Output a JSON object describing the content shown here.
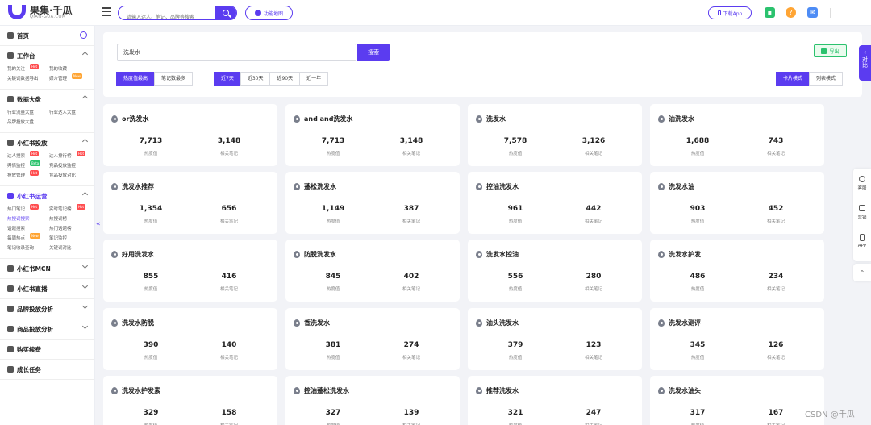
{
  "brand": {
    "name": "果集·千瓜",
    "sub": "QIAN-GUA.COM",
    "accent": "#5b3cf0"
  },
  "topbar": {
    "search_placeholder": "请输入达人、笔记、品牌等搜索",
    "func_map": "功能地图",
    "download_app": "下载App"
  },
  "sidebar": {
    "home": "首页",
    "sections": [
      {
        "title": "工作台",
        "items": [
          {
            "label": "我的关注",
            "badge": "Hot"
          },
          {
            "label": "我的收藏",
            "badge": ""
          },
          {
            "label": "关键词数据导出",
            "badge": ""
          },
          {
            "label": "媒介管理",
            "badge": "New"
          }
        ]
      },
      {
        "title": "数据大盘",
        "items": [
          {
            "label": "行业流量大盘",
            "badge": ""
          },
          {
            "label": "行业达人大盘",
            "badge": ""
          },
          {
            "label": "品牌投放大盘",
            "badge": ""
          }
        ]
      },
      {
        "title": "小红书投放",
        "items": [
          {
            "label": "达人搜索",
            "badge": "Hot"
          },
          {
            "label": "达人排行榜",
            "badge": "Hot"
          },
          {
            "label": "舆情监控",
            "badge": "Beta"
          },
          {
            "label": "竞品投放监控",
            "badge": ""
          },
          {
            "label": "投放管理",
            "badge": "Hot"
          },
          {
            "label": "竞品投放对比",
            "badge": ""
          }
        ]
      },
      {
        "title": "小红书运营",
        "items": [
          {
            "label": "热门笔记",
            "badge": "Hot"
          },
          {
            "label": "实时笔记榜",
            "badge": "Hot"
          },
          {
            "label": "热搜词搜索",
            "badge": ""
          },
          {
            "label": "热搜词榜",
            "badge": ""
          },
          {
            "label": "话题搜索",
            "badge": ""
          },
          {
            "label": "热门话题榜",
            "badge": ""
          },
          {
            "label": "每周热点",
            "badge": "New"
          },
          {
            "label": "笔记监控",
            "badge": ""
          },
          {
            "label": "笔记收录查询",
            "badge": ""
          },
          {
            "label": "关键词对比",
            "badge": ""
          }
        ]
      }
    ],
    "collapsed": [
      "小红书MCN",
      "小红书直播",
      "品牌投放分析",
      "商品投放分析",
      "购买续费",
      "成长任务"
    ]
  },
  "main": {
    "keyword": "洗发水",
    "search_button": "搜索",
    "export": "导出",
    "sort_tabs": [
      "热度值最高",
      "笔记数最多"
    ],
    "time_tabs": [
      "近7天",
      "近30天",
      "近90天",
      "近一年"
    ],
    "view_tabs": [
      "卡片模式",
      "列表模式"
    ],
    "value_label": "热度值",
    "notes_label": "相关笔记"
  },
  "cards": [
    {
      "title": "or洗发水",
      "heat": "7,713",
      "notes": "3,148"
    },
    {
      "title": "and and洗发水",
      "heat": "7,713",
      "notes": "3,148"
    },
    {
      "title": "洗发水",
      "heat": "7,578",
      "notes": "3,126"
    },
    {
      "title": "油洗发水",
      "heat": "1,688",
      "notes": "743"
    },
    {
      "title": "洗发水推荐",
      "heat": "1,354",
      "notes": "656"
    },
    {
      "title": "蓬松洗发水",
      "heat": "1,149",
      "notes": "387"
    },
    {
      "title": "控油洗发水",
      "heat": "961",
      "notes": "442"
    },
    {
      "title": "洗发水油",
      "heat": "903",
      "notes": "452"
    },
    {
      "title": "好用洗发水",
      "heat": "855",
      "notes": "416"
    },
    {
      "title": "防脱洗发水",
      "heat": "845",
      "notes": "402"
    },
    {
      "title": "洗发水控油",
      "heat": "556",
      "notes": "280"
    },
    {
      "title": "洗发水护发",
      "heat": "486",
      "notes": "234"
    },
    {
      "title": "洗发水防脱",
      "heat": "390",
      "notes": "140"
    },
    {
      "title": "香洗发水",
      "heat": "381",
      "notes": "274"
    },
    {
      "title": "油头洗发水",
      "heat": "379",
      "notes": "123"
    },
    {
      "title": "洗发水测评",
      "heat": "345",
      "notes": "126"
    },
    {
      "title": "洗发水护发素",
      "heat": "329",
      "notes": "158"
    },
    {
      "title": "控油蓬松洗发水",
      "heat": "327",
      "notes": "139"
    },
    {
      "title": "推荐洗发水",
      "heat": "321",
      "notes": "247"
    },
    {
      "title": "洗发水油头",
      "heat": "317",
      "notes": "167"
    }
  ],
  "right_tab": "对比",
  "right_panel": [
    "客服",
    "营销",
    "APP"
  ],
  "watermark": "CSDN @千瓜"
}
